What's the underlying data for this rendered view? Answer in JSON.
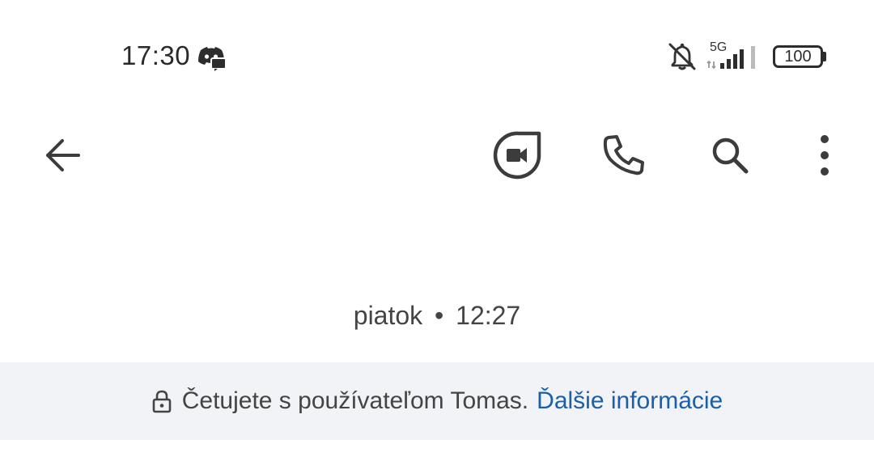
{
  "status_bar": {
    "time": "17:30",
    "network": "5G",
    "battery": "100",
    "icons": [
      "discord-icon",
      "mute-icon",
      "signal-icon",
      "battery-icon"
    ]
  },
  "toolbar": {
    "icons": [
      "back-arrow-icon",
      "video-call-icon",
      "phone-icon",
      "search-icon",
      "more-vert-icon"
    ]
  },
  "conversation": {
    "date_day": "piatok",
    "date_separator": "•",
    "date_time": "12:27"
  },
  "banner": {
    "text": "Četujete s používateľom Tomas.",
    "link": "Ďalšie informácie"
  },
  "colors": {
    "link": "#1a5fa8",
    "banner_bg": "#f1f3f7",
    "icon": "#3c3c3c"
  }
}
